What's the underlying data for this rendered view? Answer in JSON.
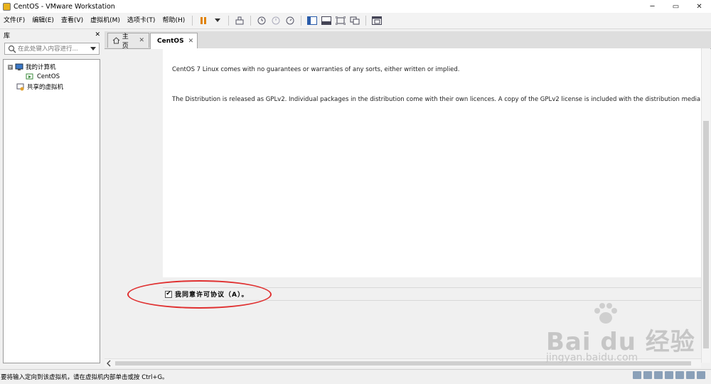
{
  "window": {
    "title": "CentOS - VMware Workstation",
    "minimize": "─",
    "restore": "▭",
    "close": "✕"
  },
  "menu": [
    "文件(F)",
    "编辑(E)",
    "查看(V)",
    "虚拟机(M)",
    "选项卡(T)",
    "帮助(H)"
  ],
  "toolbar": {
    "icons": [
      "pause-icon",
      "dropdown-arrow-icon",
      "send-keys-icon",
      "snapshot-take-icon",
      "snapshot-revert-icon",
      "snapshot-manager-icon",
      "view-library-icon",
      "view-thumbnail-icon",
      "fullscreen-icon",
      "unity-icon",
      "console-view-icon"
    ]
  },
  "library": {
    "title": "库",
    "close": "✕",
    "search_placeholder": "在此处键入内容进行...",
    "tree": {
      "root": "我的计算机",
      "child": "CentOS",
      "shared": "共享的虚拟机",
      "expander": "⊟"
    }
  },
  "tabs": [
    {
      "label": "主页",
      "close": "✕",
      "active": false
    },
    {
      "label": "CentOS",
      "close": "✕",
      "active": true
    }
  ],
  "license": {
    "line1": "CentOS 7 Linux comes with no guarantees or warranties of any sorts, either written or implied.",
    "line2": "The Distribution is released as GPLv2. Individual packages in the distribution come with their own licences. A copy of the GPLv2 license is included with the distribution media."
  },
  "agree": {
    "label": "我同意许可协议（A）。",
    "checked": true,
    "mark": "✔"
  },
  "status": {
    "text": "要将输入定向到该虚拟机，请在虚拟机内部单击或按 Ctrl+G。"
  },
  "watermark": {
    "brand": "Bai du 经验",
    "sub": "jingyan.baidu.com"
  },
  "colors": {
    "annotation": "#e03030",
    "pause": "#e0830b"
  }
}
